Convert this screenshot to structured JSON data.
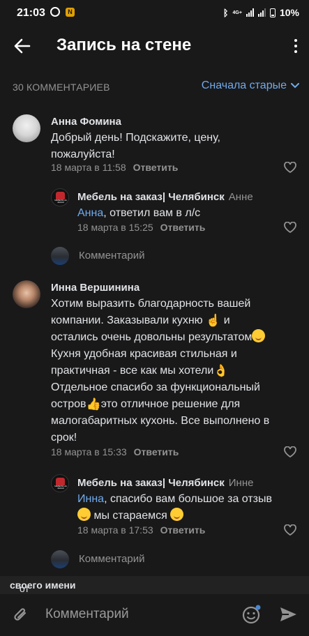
{
  "status": {
    "time": "21:03",
    "network": "4G+",
    "battery": "10%",
    "notification_badge": "N"
  },
  "header": {
    "title": "Запись на стене"
  },
  "sort_row": {
    "count_label": "30 КОММЕНТАРИЕВ",
    "sort_label": "Сначала старые"
  },
  "comments": [
    {
      "author": "Анна Фомина",
      "text_line1": "Добрый день! Подскажите, цену,",
      "text_line2": "пожалуйста!",
      "date": "18 марта в 11:58",
      "reply_label": "Ответить"
    },
    {
      "author": "Мебель на заказ| Челябинск",
      "to": "Анне",
      "mention": "Анна",
      "text_rest": ", ответил вам в л/с",
      "date": "18 марта в 15:25",
      "reply_label": "Ответить",
      "logo_text": "МЕБЕЛЬ НА ЗАКАЗ"
    },
    {
      "author": "Инна Вершинина",
      "line1": "Хотим выразить благодарность вашей",
      "line2a": "компании. Заказывали кухню ",
      "line2b": " и",
      "line3": "остались очень довольны результатом",
      "line4": "Кухня удобная красивая стильная и",
      "line5": "практичная - все как мы хотели",
      "line6": "Отдельное спасибо за функциональный",
      "line7a": "остров",
      "line7b": "это отличное решение для",
      "line8": "малогабаритных кухонь. Все выполнено в",
      "line9": "срок!",
      "date": "18 марта в 15:33",
      "reply_label": "Ответить"
    },
    {
      "author": "Мебель на заказ| Челябинск",
      "to": "Инне",
      "mention": "Инна",
      "text_rest": ", спасибо вам большое за отзыв",
      "line2": " мы стараемся",
      "date": "18 марта в 17:53",
      "reply_label": "Ответить",
      "logo_text": "МЕБЕЛЬ НА ЗАКАЗ"
    }
  ],
  "add_comment_label": "Комментарий",
  "composer": {
    "as_prefix": "от",
    "as_bold": "своего имени",
    "placeholder": "Комментарий"
  },
  "colors": {
    "background": "#19191a",
    "accent": "#71aaeb",
    "muted": "#939393",
    "text": "#e1e3e6"
  }
}
